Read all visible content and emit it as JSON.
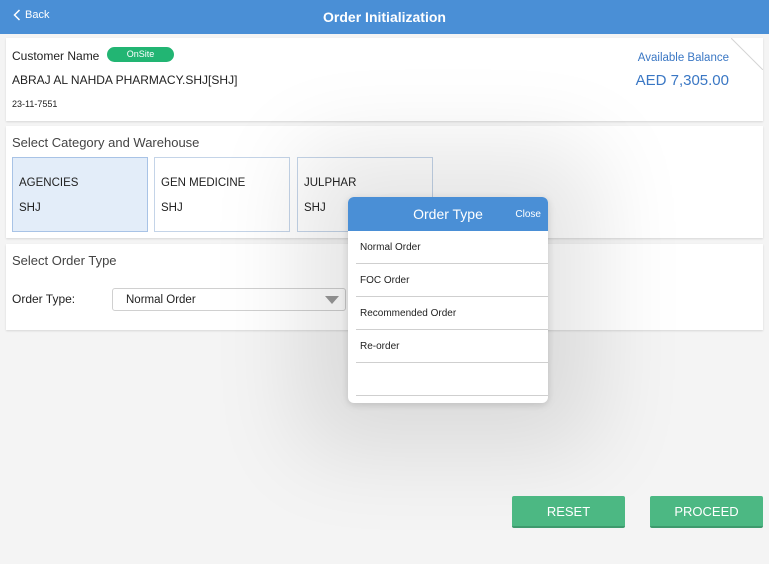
{
  "header": {
    "back_label": "Back",
    "title": "Order Initialization"
  },
  "customer": {
    "label": "Customer Name",
    "badge": "OnSite",
    "name": "ABRAJ AL NAHDA PHARMACY.SHJ[SHJ]",
    "code": "23-11-7551",
    "balance_label": "Available Balance",
    "balance_value": "AED 7,305.00"
  },
  "category": {
    "title": "Select Category and Warehouse",
    "warehouses": [
      {
        "name": "AGENCIES",
        "location": "SHJ"
      },
      {
        "name": "GEN MEDICINE",
        "location": "SHJ"
      },
      {
        "name": "JULPHAR",
        "location": "SHJ"
      }
    ]
  },
  "order_type": {
    "title": "Select Order Type",
    "label": "Order Type:",
    "selected": "Normal Order"
  },
  "popup": {
    "title": "Order Type",
    "close_label": "Close",
    "options": [
      "Normal Order",
      "FOC Order",
      "Recommended Order",
      "Re-order",
      ""
    ]
  },
  "buttons": {
    "reset": "RESET",
    "proceed": "PROCEED"
  },
  "colors": {
    "accent": "#4a8fd6",
    "button": "#4cb883",
    "badge": "#22b573",
    "balance": "#3a77c4"
  }
}
